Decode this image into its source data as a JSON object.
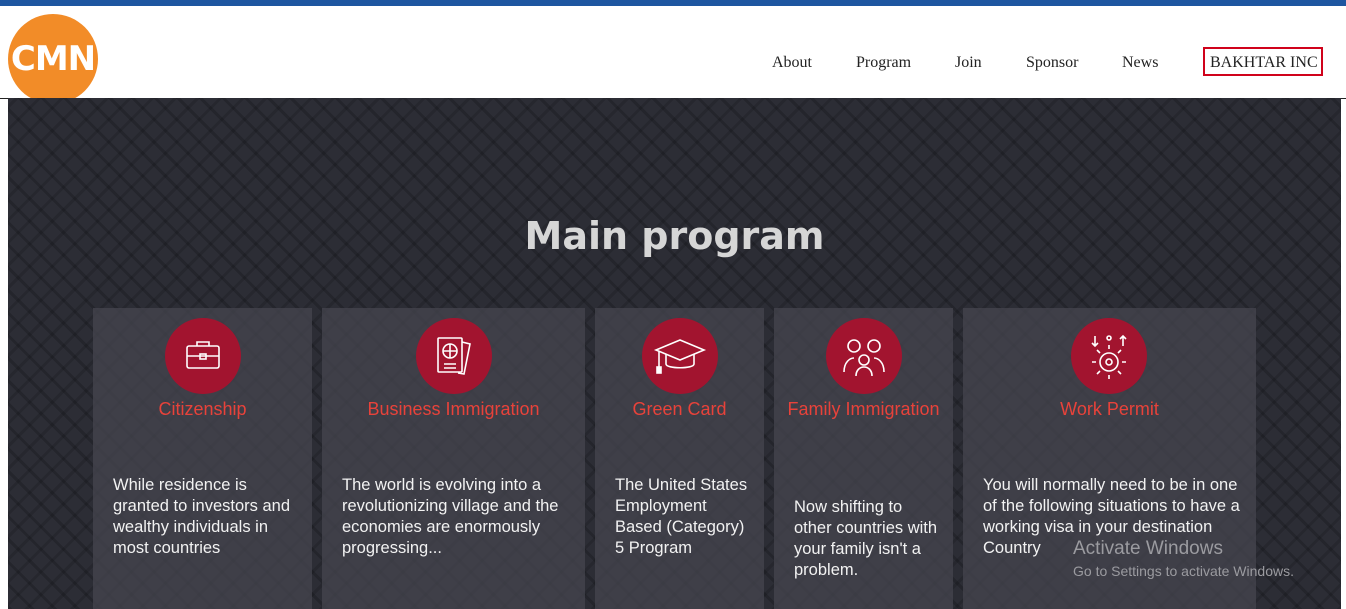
{
  "header": {
    "logo_text": "CMN",
    "nav": [
      "About",
      "Program",
      "Join",
      "Sponsor",
      "News",
      "BAKHTAR INC"
    ]
  },
  "hero": {
    "title": "Main program"
  },
  "cards": [
    {
      "icon": "briefcase-icon",
      "title": "Citizenship",
      "text": "While residence is granted to investors and wealthy individuals in most countries"
    },
    {
      "icon": "passport-icon",
      "title": "Business Immigration",
      "text": "The world is evolving into a revolutionizing village and the economies are enormously progressing..."
    },
    {
      "icon": "graduation-cap-icon",
      "title": "Green Card",
      "text": "The United States Employment Based (Category) 5 Program"
    },
    {
      "icon": "family-icon",
      "title": "Family Immigration",
      "text": "Now shifting to other countries with your family isn't a problem."
    },
    {
      "icon": "work-gear-icon",
      "title": "Work Permit",
      "text": "You will normally need to be in one of the following situations to have a working visa in your destination Country"
    }
  ],
  "watermark": {
    "line1": "Activate Windows",
    "line2": "Go to Settings to activate Windows."
  },
  "colors": {
    "accent": "#e8423a",
    "icon_bg": "#a2142f",
    "logo_bg": "#f28c28",
    "topbar": "#1e56a0",
    "hero_bg": "#2c2d35"
  }
}
